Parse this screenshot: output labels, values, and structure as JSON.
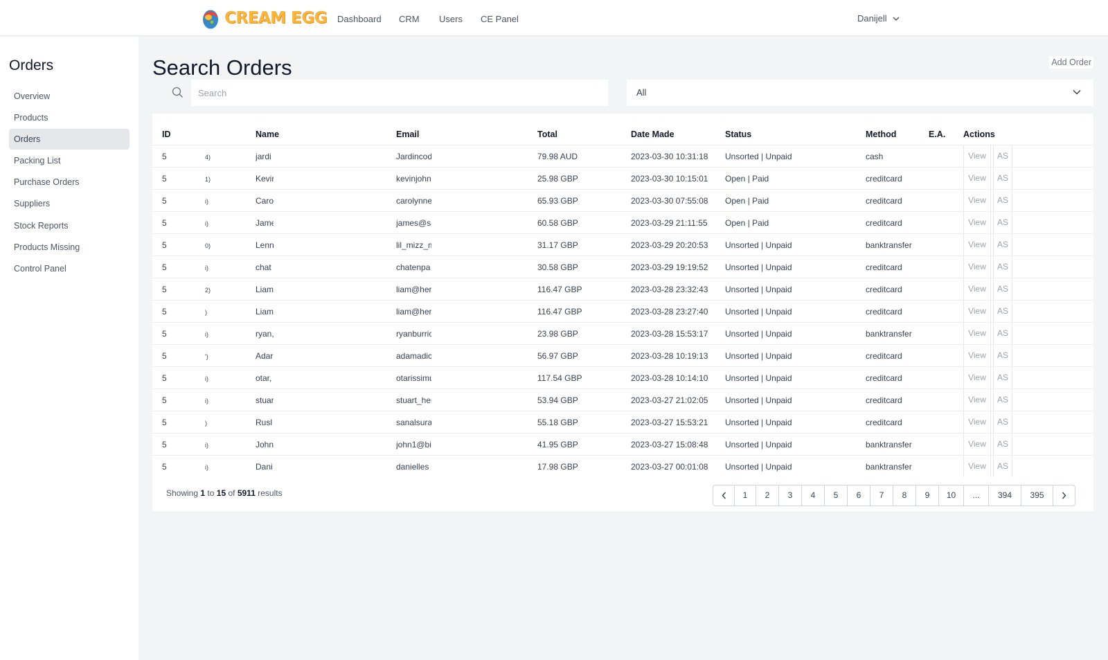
{
  "header": {
    "logo_text": "CREAM EGG",
    "nav": [
      {
        "label": "Dashboard"
      },
      {
        "label": "CRM"
      },
      {
        "label": "Users"
      },
      {
        "label": "CE Panel"
      }
    ],
    "user": "Danijell"
  },
  "sidebar": {
    "title": "Orders",
    "items": [
      {
        "label": "Overview"
      },
      {
        "label": "Products"
      },
      {
        "label": "Orders",
        "active": true
      },
      {
        "label": "Packing List"
      },
      {
        "label": "Purchase Orders"
      },
      {
        "label": "Suppliers"
      },
      {
        "label": "Stock Reports"
      },
      {
        "label": "Products Missing"
      },
      {
        "label": "Control Panel"
      }
    ]
  },
  "main": {
    "title": "Search Orders",
    "add_order_label": "Add Order",
    "search_placeholder": "Search",
    "filter_value": "All"
  },
  "table": {
    "columns": [
      "ID",
      "Name",
      "Email",
      "Total",
      "Date Made",
      "Status",
      "Method",
      "E.A.",
      "Actions"
    ],
    "view_label": "View",
    "as_label": "AS",
    "rows": [
      {
        "id": "5",
        "ref": "4)",
        "name": "jardi",
        "email": "Jardincod",
        "total": "79.98 AUD",
        "date": "2023-03-30 10:31:18",
        "status": "Unsorted | Unpaid",
        "method": "cash"
      },
      {
        "id": "5",
        "ref": "1)",
        "name": "Kevir",
        "email": "kevinjohn",
        "total": "25.98 GBP",
        "date": "2023-03-30 10:15:01",
        "status": "Open | Paid",
        "method": "creditcard"
      },
      {
        "id": "5",
        "ref": "i)",
        "name": "Caro",
        "email": "carolynne",
        "total": "65.93 GBP",
        "date": "2023-03-30 07:55:08",
        "status": "Open | Paid",
        "method": "creditcard"
      },
      {
        "id": "5",
        "ref": "i)",
        "name": "Jame",
        "email": "james@sa",
        "total": "60.58 GBP",
        "date": "2023-03-29 21:11:55",
        "status": "Open | Paid",
        "method": "creditcard"
      },
      {
        "id": "5",
        "ref": "0)",
        "name": "Lenn",
        "email": "lil_mizz_m",
        "total": "31.17 GBP",
        "date": "2023-03-29 20:20:53",
        "status": "Unsorted | Unpaid",
        "method": "banktransfer"
      },
      {
        "id": "5",
        "ref": "i)",
        "name": "chat",
        "email": "chatenpa",
        "total": "30.58 GBP",
        "date": "2023-03-29 19:19:52",
        "status": "Unsorted | Unpaid",
        "method": "creditcard"
      },
      {
        "id": "5",
        "ref": "2)",
        "name": "Liam",
        "email": "liam@her",
        "total": "116.47 GBP",
        "date": "2023-03-28 23:32:43",
        "status": "Unsorted | Unpaid",
        "method": "creditcard"
      },
      {
        "id": "5",
        "ref": ")",
        "name": "Liam",
        "email": "liam@her",
        "total": "116.47 GBP",
        "date": "2023-03-28 23:27:40",
        "status": "Unsorted | Unpaid",
        "method": "creditcard"
      },
      {
        "id": "5",
        "ref": "i)",
        "name": "ryan,",
        "email": "ryanburric",
        "total": "23.98 GBP",
        "date": "2023-03-28 15:53:17",
        "status": "Unsorted | Unpaid",
        "method": "banktransfer"
      },
      {
        "id": "5",
        "ref": "')",
        "name": "Adar",
        "email": "adamadic",
        "total": "56.97 GBP",
        "date": "2023-03-28 10:19:13",
        "status": "Unsorted | Unpaid",
        "method": "creditcard"
      },
      {
        "id": "5",
        "ref": "i)",
        "name": "otar,",
        "email": "otarissimu",
        "total": "117.54 GBP",
        "date": "2023-03-28 10:14:10",
        "status": "Unsorted | Unpaid",
        "method": "creditcard"
      },
      {
        "id": "5",
        "ref": "i)",
        "name": "stuar",
        "email": "stuart_her",
        "total": "53.94 GBP",
        "date": "2023-03-27 21:02:05",
        "status": "Unsorted | Unpaid",
        "method": "creditcard"
      },
      {
        "id": "5",
        "ref": ")",
        "name": "Rusl",
        "email": "sanalsura",
        "total": "55.18 GBP",
        "date": "2023-03-27 15:53:21",
        "status": "Unsorted | Unpaid",
        "method": "creditcard"
      },
      {
        "id": "5",
        "ref": "i)",
        "name": "John",
        "email": "john1@bi",
        "total": "41.95 GBP",
        "date": "2023-03-27 15:08:48",
        "status": "Unsorted | Unpaid",
        "method": "banktransfer"
      },
      {
        "id": "5",
        "ref": "i)",
        "name": "Dani",
        "email": "danielles",
        "total": "17.98 GBP",
        "date": "2023-03-27 00:01:08",
        "status": "Unsorted | Unpaid",
        "method": "banktransfer"
      }
    ]
  },
  "results": {
    "prefix": "Showing",
    "from": "1",
    "to_word": "to",
    "to": "15",
    "of_word": "of",
    "total": "5911",
    "suffix": "results"
  },
  "pagination": {
    "pages": [
      "1",
      "2",
      "3",
      "4",
      "5",
      "6",
      "7",
      "8",
      "9",
      "10",
      "...",
      "394",
      "395"
    ]
  }
}
